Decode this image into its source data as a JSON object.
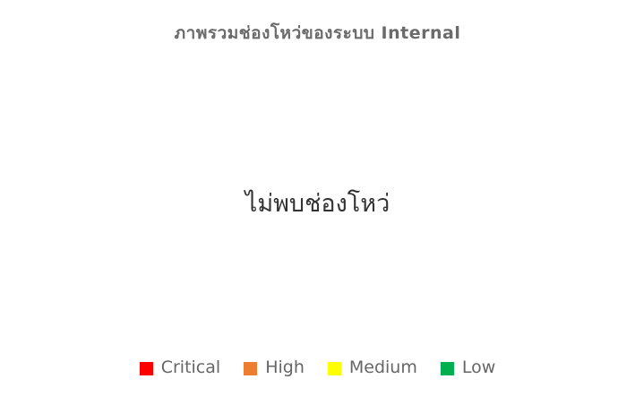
{
  "chart_data": {
    "type": "pie",
    "title": "ภาพรวมช่องโหว่ของระบบ Internal",
    "no_data_message": "ไม่พบช่องโหว่",
    "categories": [
      "Critical",
      "High",
      "Medium",
      "Low"
    ],
    "values": [],
    "colors": [
      "#ff0000",
      "#ed7d31",
      "#ffff00",
      "#00b050"
    ],
    "legend_position": "bottom"
  }
}
